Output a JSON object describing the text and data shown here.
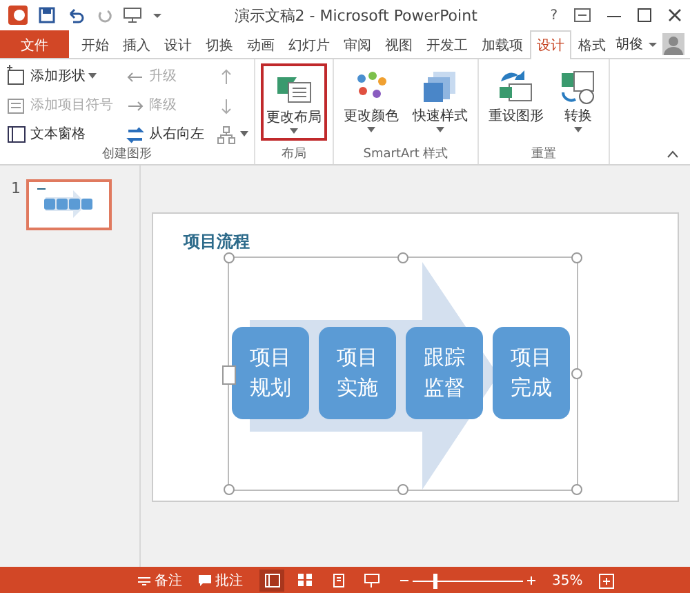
{
  "title_bar": {
    "title": "演示文稿2 - Microsoft PowerPoint",
    "help": "?"
  },
  "tabs": [
    {
      "label": "文件",
      "kind": "file",
      "selected": false
    },
    {
      "label": "开始",
      "kind": "tab",
      "selected": false
    },
    {
      "label": "插入",
      "kind": "tab",
      "selected": false
    },
    {
      "label": "设计",
      "kind": "tab",
      "selected": false
    },
    {
      "label": "切换",
      "kind": "tab",
      "selected": false
    },
    {
      "label": "动画",
      "kind": "tab",
      "selected": false
    },
    {
      "label": "幻灯片",
      "kind": "tab",
      "selected": false
    },
    {
      "label": "审阅",
      "kind": "tab",
      "selected": false
    },
    {
      "label": "视图",
      "kind": "tab",
      "selected": false
    },
    {
      "label": "开发工",
      "kind": "tab",
      "selected": false
    },
    {
      "label": "加载项",
      "kind": "tab",
      "selected": false
    },
    {
      "label": "设计",
      "kind": "tab",
      "selected": true
    },
    {
      "label": "格式",
      "kind": "tab",
      "selected": false
    }
  ],
  "user": {
    "name": "胡俊"
  },
  "ribbon": {
    "groups": [
      {
        "label": "创建图形",
        "kind": "small",
        "items": [
          {
            "label": "添加形状",
            "disabled": false,
            "dropdown": true
          },
          {
            "label": "添加项目符号",
            "disabled": true,
            "dropdown": false
          },
          {
            "label": "文本窗格",
            "disabled": false,
            "dropdown": false
          },
          {
            "label": "升级",
            "disabled": true,
            "dropdown": false
          },
          {
            "label": "降级",
            "disabled": true,
            "dropdown": false
          },
          {
            "label": "从右向左",
            "disabled": false,
            "dropdown": false
          },
          {
            "disabled": true,
            "dropdown": false
          },
          {
            "disabled": true,
            "dropdown": false
          },
          {
            "disabled": true,
            "dropdown": true
          }
        ]
      },
      {
        "label": "布局",
        "kind": "big",
        "items": [
          {
            "label": "更改布局",
            "highlighted": true,
            "dropdown": true
          }
        ]
      },
      {
        "label": "SmartArt 样式",
        "kind": "big",
        "items": [
          {
            "label": "更改颜色",
            "highlighted": false,
            "dropdown": true
          },
          {
            "label": "快速样式",
            "highlighted": false,
            "dropdown": true
          }
        ]
      },
      {
        "label": "重置",
        "kind": "big",
        "items": [
          {
            "label": "重设图形",
            "highlighted": false,
            "dropdown": false
          },
          {
            "label": "转换",
            "highlighted": false,
            "dropdown": true
          }
        ]
      }
    ]
  },
  "slides": [
    {
      "number": "1",
      "selected": true
    }
  ],
  "slide": {
    "title": "项目流程",
    "steps": [
      "项目规划",
      "项目实施",
      "跟踪监督",
      "项目完成"
    ]
  },
  "status_bar": {
    "notes": "备注",
    "comments": "批注",
    "views": [
      {
        "selected": true
      },
      {
        "selected": false
      },
      {
        "selected": false
      },
      {
        "selected": false
      }
    ],
    "zoom": {
      "label": "35%",
      "level": 0.2
    }
  }
}
